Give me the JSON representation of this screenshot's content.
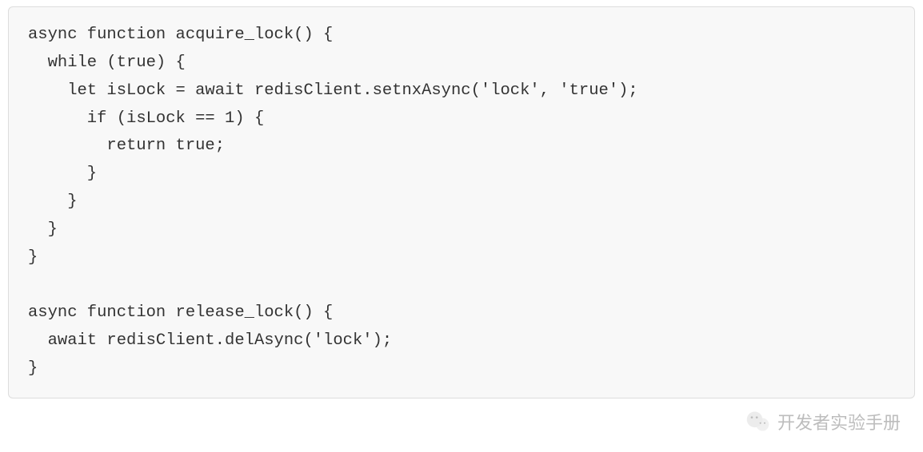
{
  "code": {
    "lines": [
      "async function acquire_lock() {",
      "  while (true) {",
      "    let isLock = await redisClient.setnxAsync('lock', 'true');",
      "      if (isLock == 1) {",
      "        return true;",
      "      }",
      "    }",
      "  }",
      "}",
      "",
      "async function release_lock() {",
      "  await redisClient.delAsync('lock');",
      "}"
    ]
  },
  "watermark": {
    "text": "开发者实验手册"
  }
}
